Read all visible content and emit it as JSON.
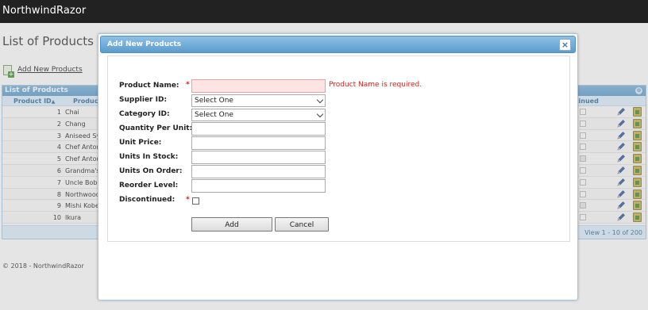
{
  "app": {
    "brand": "NorthwindRazor"
  },
  "page": {
    "title": "List of Products",
    "add_link": "Add New Products",
    "footer": "© 2018 - NorthwindRazor"
  },
  "grid": {
    "caption": "List of Products",
    "headers": {
      "product_id": "Product ID",
      "product_name": "Product",
      "discontinued": "ntinued"
    },
    "sort_icon": "sort-asc-icon",
    "rows": [
      {
        "id": "1",
        "name": "Chai",
        "discontinued": false
      },
      {
        "id": "2",
        "name": "Chang",
        "discontinued": false
      },
      {
        "id": "3",
        "name": "Aniseed Syr",
        "discontinued": false
      },
      {
        "id": "4",
        "name": "Chef Anton'",
        "discontinued": false
      },
      {
        "id": "5",
        "name": "Chef Anton'",
        "discontinued": true
      },
      {
        "id": "6",
        "name": "Grandma's I",
        "discontinued": false
      },
      {
        "id": "7",
        "name": "Uncle Bob's",
        "discontinued": false
      },
      {
        "id": "8",
        "name": "Northwoods",
        "discontinued": false
      },
      {
        "id": "9",
        "name": "Mishi Kobe",
        "discontinued": true
      },
      {
        "id": "10",
        "name": "Ikura",
        "discontinued": false
      }
    ],
    "pager": "View 1 - 10 of 200"
  },
  "dialog": {
    "title": "Add New Products",
    "close_icon": "close-icon",
    "fields": {
      "product_name": {
        "label": "Product Name:",
        "value": "",
        "required": "*",
        "error": "Product Name is required."
      },
      "supplier_id": {
        "label": "Supplier ID:",
        "value": "Select One"
      },
      "category_id": {
        "label": "Category ID:",
        "value": "Select One"
      },
      "quantity_per_unit": {
        "label": "Quantity Per Unit:",
        "value": ""
      },
      "unit_price": {
        "label": "Unit Price:",
        "value": ""
      },
      "units_in_stock": {
        "label": "Units In Stock:",
        "value": ""
      },
      "units_on_order": {
        "label": "Units On Order:",
        "value": ""
      },
      "reorder_level": {
        "label": "Reorder Level:",
        "value": ""
      },
      "discontinued": {
        "label": "Discontinued:",
        "required": "*",
        "checked": false
      }
    },
    "buttons": {
      "add": "Add",
      "cancel": "Cancel"
    }
  },
  "colors": {
    "navbar": "#222222",
    "dialog_title": "#5c9ccc",
    "error": "#d61f1f",
    "invalid_input": "#ffe4e4"
  }
}
